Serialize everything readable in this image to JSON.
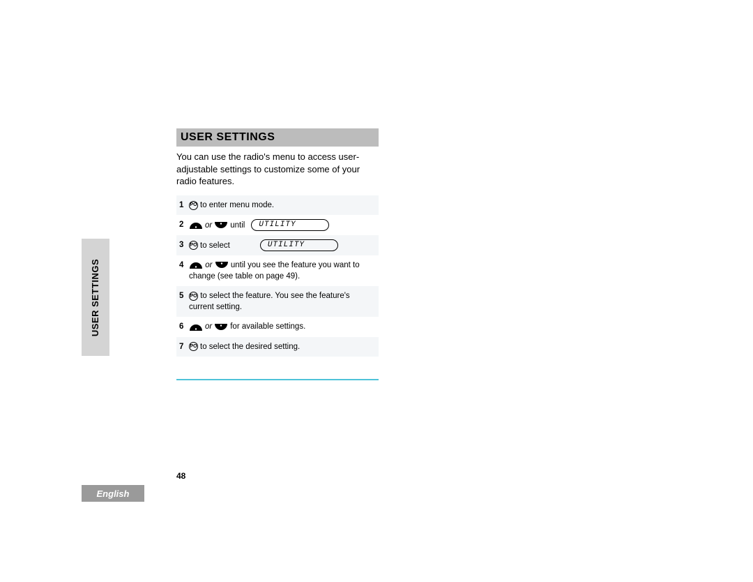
{
  "doc": {
    "side_tab": "USER SETTINGS",
    "header": "USER SETTINGS",
    "intro": "You can use the radio's menu to access user-adjustable settings to customize some of your radio features.",
    "steps": {
      "s1": {
        "n": "1",
        "suffix": "to enter menu mode."
      },
      "s2": {
        "n": "2",
        "or": "or",
        "until": "until",
        "display": "UTILITY"
      },
      "s3": {
        "n": "3",
        "suffix": "to select",
        "display": "UTILITY"
      },
      "s4": {
        "n": "4",
        "or": "or",
        "suffix": "until you see the feature you want to change (see table on page 49)."
      },
      "s5": {
        "n": "5",
        "suffix": "to select the feature. You see the feature's current setting."
      },
      "s6": {
        "n": "6",
        "or": "or",
        "suffix": "for available settings."
      },
      "s7": {
        "n": "7",
        "suffix": "to select the desired setting."
      }
    },
    "page_number": "48",
    "language": "English",
    "icons": {
      "menu_key": "PO"
    }
  }
}
